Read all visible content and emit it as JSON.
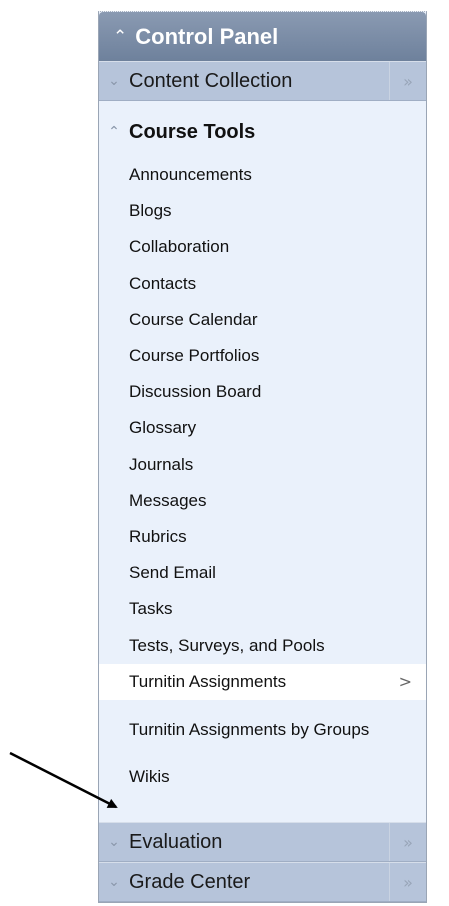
{
  "control_panel": {
    "title": "Control Panel",
    "collapse_glyph": "»"
  },
  "content_collection": {
    "label": "Content Collection",
    "expand_glyph": "»"
  },
  "course_tools": {
    "label": "Course Tools",
    "items": [
      "Announcements",
      "Blogs",
      "Collaboration",
      "Contacts",
      "Course Calendar",
      "Course Portfolios",
      "Discussion Board",
      "Glossary",
      "Journals",
      "Messages",
      "Rubrics",
      "Send Email",
      "Tasks",
      "Tests, Surveys, and Pools",
      "Turnitin Assignments",
      "Turnitin Assignments by Groups",
      "Wikis"
    ],
    "selected_item": "Turnitin Assignments",
    "selected_arrow": ">"
  },
  "evaluation": {
    "label": "Evaluation",
    "expand_glyph": "»"
  },
  "grade_center": {
    "label": "Grade Center",
    "expand_glyph": "»"
  },
  "icons": {
    "collapse": "chevron-up-icon",
    "expand": "chevron-down-icon",
    "open_section": "double-chevron-right-icon"
  },
  "colors": {
    "header_bg": "#7a8ca6",
    "section_bg": "#b6c4da",
    "panel_bg": "#eaf1fb",
    "selected_bg": "#ffffff"
  }
}
